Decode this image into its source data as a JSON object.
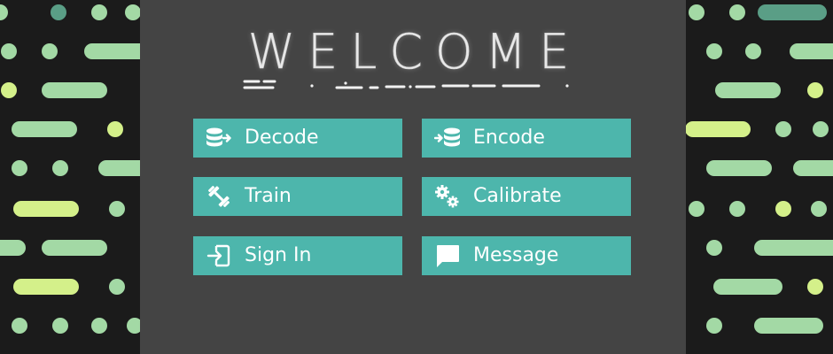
{
  "header": {
    "title": "WELCOME"
  },
  "buttons": {
    "decode": {
      "label": "Decode",
      "icon": "database-arrow-in-icon"
    },
    "encode": {
      "label": "Encode",
      "icon": "arrow-database-icon"
    },
    "train": {
      "label": "Train",
      "icon": "dumbbell-icon"
    },
    "calibrate": {
      "label": "Calibrate",
      "icon": "gears-icon"
    },
    "sign_in": {
      "label": "Sign In",
      "icon": "login-icon"
    },
    "message": {
      "label": "Message",
      "icon": "chat-bubble-icon"
    }
  },
  "colors": {
    "accent": "#4db6ac",
    "panel": "#444444",
    "background": "#1b1b1b",
    "pattern_green_light": "#a3d9a5",
    "pattern_yellow_green": "#d4f08a",
    "pattern_dark_teal": "#5a9e86"
  }
}
